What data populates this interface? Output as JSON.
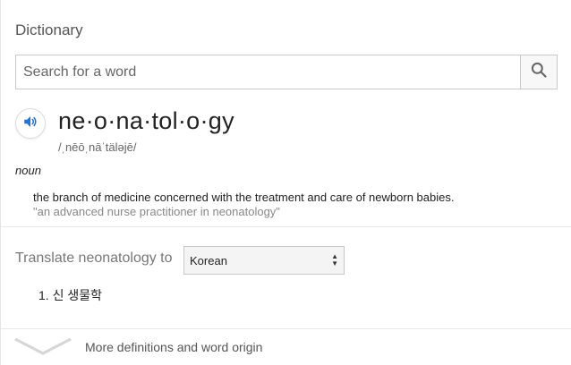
{
  "card": {
    "title": "Dictionary"
  },
  "search": {
    "placeholder": "Search for a word",
    "value": ""
  },
  "entry": {
    "headword": "ne·o·na·tol·o·gy",
    "phonetic": "/ˌnēōˌnāˈtäləjē/",
    "part_of_speech": "noun",
    "definition": "the branch of medicine concerned with the treatment and care of newborn babies.",
    "example": "\"an advanced nurse practitioner in neonatology\""
  },
  "translate": {
    "label": "Translate neonatology to",
    "selected_language": "Korean",
    "results": [
      {
        "number": "1.",
        "text": "신 생물학"
      }
    ]
  },
  "footer": {
    "more_label": "More definitions and word origin"
  },
  "icons": {
    "search": "search-icon",
    "speaker": "speaker-icon",
    "select_arrows": "up-down-arrows-icon",
    "expand": "chevron-down-icon"
  },
  "colors": {
    "speaker_blue": "#1a73e8",
    "text_primary": "#222222",
    "text_muted": "#888888"
  }
}
